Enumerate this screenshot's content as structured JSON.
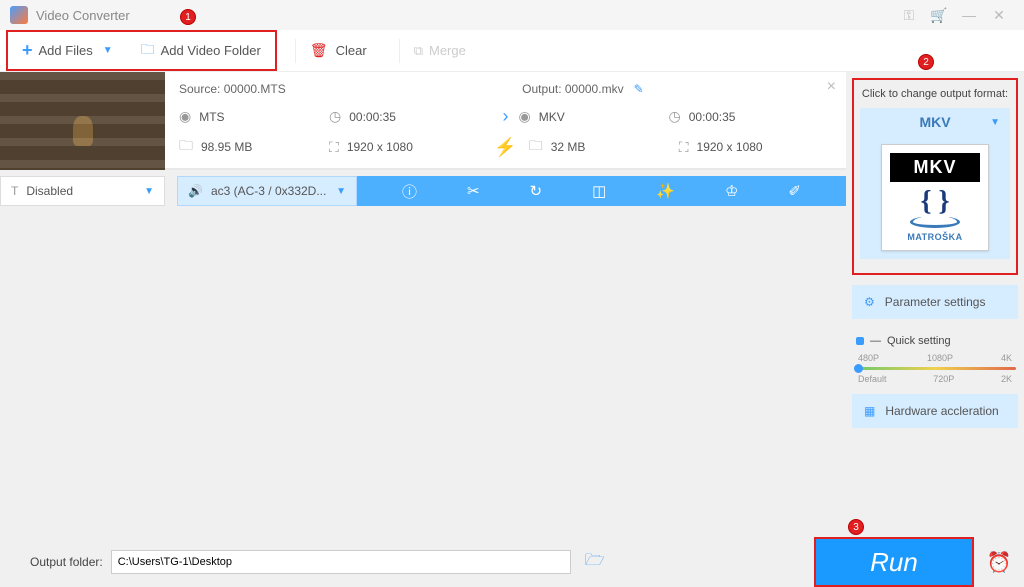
{
  "app": {
    "title": "Video Converter"
  },
  "callouts": {
    "c1": "1",
    "c2": "2",
    "c3": "3"
  },
  "toolbar": {
    "add_files": "Add Files",
    "add_folder": "Add Video Folder",
    "clear": "Clear",
    "merge": "Merge"
  },
  "item": {
    "source_label": "Source: 00000.MTS",
    "output_label": "Output: 00000.mkv",
    "src_format": "MTS",
    "src_duration": "00:00:35",
    "src_size": "98.95 MB",
    "src_res": "1920 x 1080",
    "out_format": "MKV",
    "out_duration": "00:00:35",
    "out_size": "32 MB",
    "out_res": "1920 x 1080"
  },
  "controls": {
    "subtitle": "Disabled",
    "audio": "ac3 (AC-3 / 0x332D..."
  },
  "right": {
    "title": "Click to change output format:",
    "format": "MKV",
    "card_text": "MKV",
    "card_sub": "MATROŠKA",
    "param_btn": "Parameter settings",
    "quick_label": "Quick setting",
    "scale_top": [
      "480P",
      "1080P",
      "4K"
    ],
    "scale_bot": [
      "Default",
      "720P",
      "2K"
    ],
    "hw_btn": "Hardware accleration"
  },
  "footer": {
    "label": "Output folder:",
    "path": "C:\\Users\\TG-1\\Desktop",
    "run": "Run"
  }
}
